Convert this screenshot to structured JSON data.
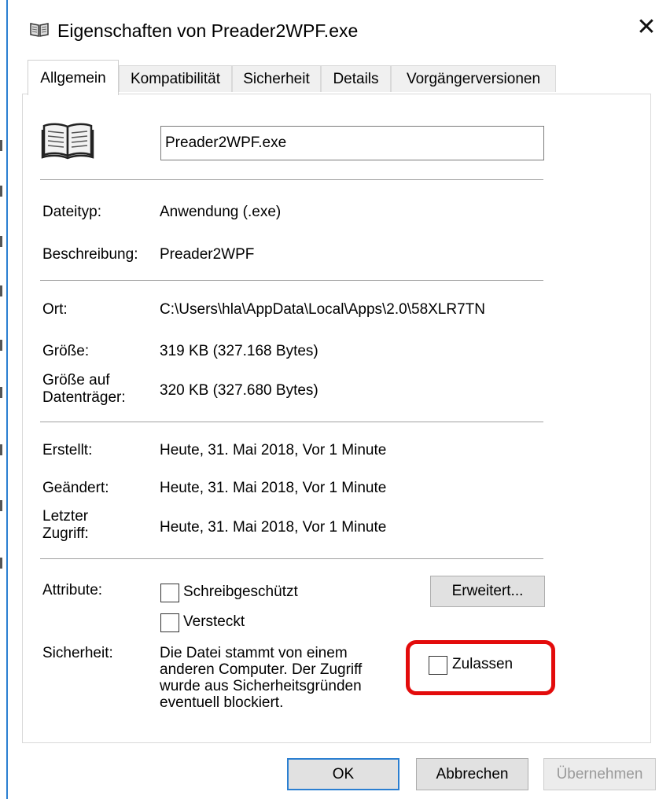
{
  "window": {
    "title": "Eigenschaften von Preader2WPF.exe",
    "close_glyph": "✕",
    "icon": "book-icon"
  },
  "tabs": [
    {
      "label": "Allgemein",
      "active": true
    },
    {
      "label": "Kompatibilität",
      "active": false
    },
    {
      "label": "Sicherheit",
      "active": false
    },
    {
      "label": "Details",
      "active": false
    },
    {
      "label": "Vorgängerversionen",
      "active": false
    }
  ],
  "general": {
    "file_icon": "book-icon",
    "filename": "Preader2WPF.exe",
    "filetype_label": "Dateityp:",
    "filetype_value": "Anwendung (.exe)",
    "description_label": "Beschreibung:",
    "description_value": "Preader2WPF",
    "location_label": "Ort:",
    "location_value": "C:\\Users\\hla\\AppData\\Local\\Apps\\2.0\\58XLR7TN",
    "size_label": "Größe:",
    "size_value": "319 KB (327.168 Bytes)",
    "disk_size_label_line1": "Größe auf",
    "disk_size_label_line2": "Datenträger:",
    "disk_size_value": "320 KB (327.680 Bytes)",
    "created_label": "Erstellt:",
    "created_value": "Heute, 31. Mai 2018, Vor 1 Minute",
    "modified_label": "Geändert:",
    "modified_value": "Heute, 31. Mai 2018, Vor 1 Minute",
    "accessed_label_line1": "Letzter",
    "accessed_label_line2": "Zugriff:",
    "accessed_value": "Heute, 31. Mai 2018, Vor 1 Minute",
    "attributes_label": "Attribute:",
    "readonly_label": "Schreibgeschützt",
    "readonly_checked": false,
    "hidden_label": "Versteckt",
    "hidden_checked": false,
    "advanced_button": "Erweitert...",
    "security_label": "Sicherheit:",
    "security_text_lines": [
      "Die Datei stammt von einem",
      "anderen Computer. Der Zugriff",
      "wurde aus Sicherheitsgründen",
      "eventuell blockiert."
    ],
    "unblock_label": "Zulassen",
    "unblock_checked": false
  },
  "buttons": {
    "ok": "OK",
    "cancel": "Abbrechen",
    "apply": "Übernehmen"
  },
  "colors": {
    "highlight": "#e30b0b",
    "default_button_border": "#2b7fd1"
  }
}
